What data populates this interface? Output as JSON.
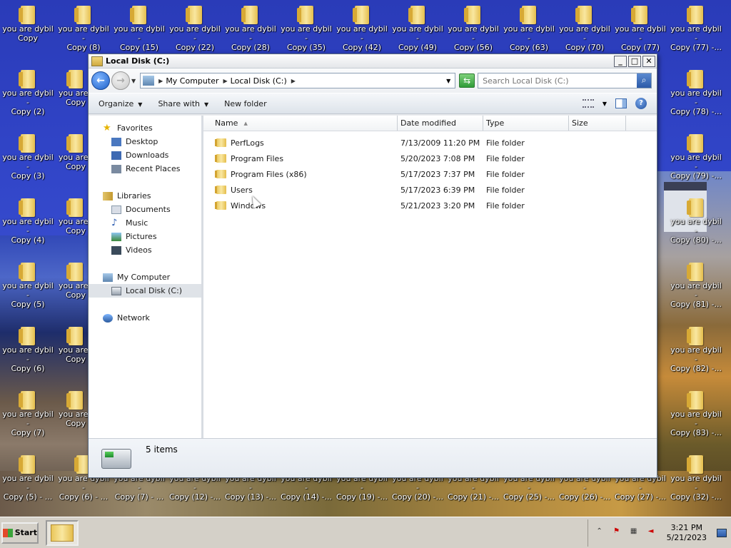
{
  "desktop": {
    "icon_top_row": [
      {
        "line1": "you are dybil",
        "line2": "Copy"
      },
      {
        "line1": "you are dybil -",
        "line2": "Copy (8)"
      },
      {
        "line1": "you are dybil -",
        "line2": "Copy (15)"
      },
      {
        "line1": "you are dybil -",
        "line2": "Copy (22)"
      },
      {
        "line1": "you are dybil -",
        "line2": "Copy (28)"
      },
      {
        "line1": "you are dybil -",
        "line2": "Copy (35)"
      },
      {
        "line1": "you are dybil -",
        "line2": "Copy (42)"
      },
      {
        "line1": "you are dybil -",
        "line2": "Copy (49)"
      },
      {
        "line1": "you are dybil -",
        "line2": "Copy (56)"
      },
      {
        "line1": "you are dybil -",
        "line2": "Copy (63)"
      },
      {
        "line1": "you are dybil -",
        "line2": "Copy (70)"
      },
      {
        "line1": "you are dybil -",
        "line2": "Copy (77)"
      },
      {
        "line1": "you are dybil -",
        "line2": "Copy (77) -..."
      }
    ],
    "icon_left_col": [
      {
        "line1": "you are dybil -",
        "line2": "Copy (2)"
      },
      {
        "line1": "you are dybil -",
        "line2": "Copy (3)"
      },
      {
        "line1": "you are dybil -",
        "line2": "Copy (4)"
      },
      {
        "line1": "you are dybil -",
        "line2": "Copy (5)"
      },
      {
        "line1": "you are dybil -",
        "line2": "Copy (6)"
      },
      {
        "line1": "you are dybil -",
        "line2": "Copy (7)"
      }
    ],
    "icon_left_col2": [
      {
        "line1": "you are",
        "line2": "Copy"
      },
      {
        "line1": "you are",
        "line2": "Copy"
      },
      {
        "line1": "you are",
        "line2": "Copy"
      },
      {
        "line1": "you are",
        "line2": "Copy"
      },
      {
        "line1": "you are",
        "line2": "Copy"
      },
      {
        "line1": "you are",
        "line2": "Copy"
      }
    ],
    "icon_right_col": [
      {
        "line1": "you are dybil -",
        "line2": "Copy (78) -..."
      },
      {
        "line1": "you are dybil -",
        "line2": "Copy (79) -..."
      },
      {
        "line1": "you are dybil -",
        "line2": "Copy (80) -..."
      },
      {
        "line1": "you are dybil -",
        "line2": "Copy (81) -..."
      },
      {
        "line1": "you are dybil -",
        "line2": "Copy (82) -..."
      },
      {
        "line1": "you are dybil -",
        "line2": "Copy (83) -..."
      }
    ],
    "icon_bottom_row": [
      {
        "line1": "you are dybil -",
        "line2": "Copy (5) - ..."
      },
      {
        "line1": "you are dybil -",
        "line2": "Copy (6) - ..."
      },
      {
        "line1": "you are dybil -",
        "line2": "Copy (7) - ..."
      },
      {
        "line1": "you are dybil -",
        "line2": "Copy (12) -..."
      },
      {
        "line1": "you are dybil -",
        "line2": "Copy (13) -..."
      },
      {
        "line1": "you are dybil -",
        "line2": "Copy (14) -..."
      },
      {
        "line1": "you are dybil -",
        "line2": "Copy (19) -..."
      },
      {
        "line1": "you are dybil -",
        "line2": "Copy (20) -..."
      },
      {
        "line1": "you are dybil -",
        "line2": "Copy (21) -..."
      },
      {
        "line1": "you are dybil -",
        "line2": "Copy (25) -..."
      },
      {
        "line1": "you are dybil -",
        "line2": "Copy (26) -..."
      },
      {
        "line1": "you are dybil -",
        "line2": "Copy (27) -..."
      },
      {
        "line1": "you are dybil -",
        "line2": "Copy (32) -..."
      }
    ]
  },
  "window": {
    "title": "Local Disk (C:)",
    "breadcrumb": [
      "My Computer",
      "Local Disk (C:)"
    ],
    "search_placeholder": "Search Local Disk (C:)",
    "toolbar": {
      "organize": "Organize",
      "share_with": "Share with",
      "new_folder": "New folder"
    },
    "nav": {
      "favorites": "Favorites",
      "desktop": "Desktop",
      "downloads": "Downloads",
      "recent_places": "Recent Places",
      "libraries": "Libraries",
      "documents": "Documents",
      "music": "Music",
      "pictures": "Pictures",
      "videos": "Videos",
      "my_computer": "My Computer",
      "local_disk": "Local Disk (C:)",
      "network": "Network"
    },
    "columns": {
      "name": "Name",
      "date_modified": "Date modified",
      "type": "Type",
      "size": "Size"
    },
    "rows": [
      {
        "name": "PerfLogs",
        "date": "7/13/2009 11:20 PM",
        "type": "File folder"
      },
      {
        "name": "Program Files",
        "date": "5/20/2023 7:08 PM",
        "type": "File folder"
      },
      {
        "name": "Program Files (x86)",
        "date": "5/17/2023 7:37 PM",
        "type": "File folder"
      },
      {
        "name": "Users",
        "date": "5/17/2023 6:39 PM",
        "type": "File folder"
      },
      {
        "name": "Windows",
        "date": "5/21/2023 3:20 PM",
        "type": "File folder"
      }
    ],
    "details": {
      "item_count": "5 items"
    }
  },
  "taskbar": {
    "start_label": "Start",
    "time": "3:21 PM",
    "date": "5/21/2023"
  }
}
